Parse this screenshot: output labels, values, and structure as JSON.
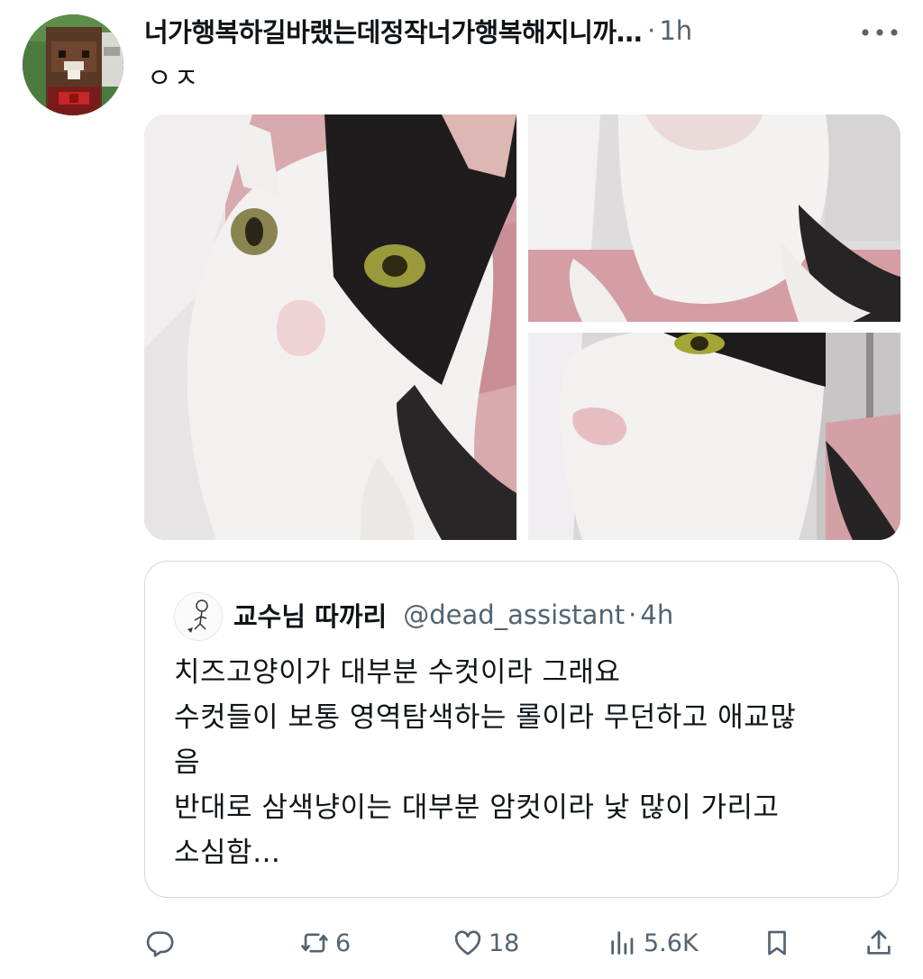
{
  "tweet": {
    "display_name": "너가행복하길바랬는데정작너가행복해지니까…",
    "separator": "·",
    "time": "1h",
    "text": "ㅇㅈ",
    "more_icon": "more-dots-icon",
    "photos": [
      {
        "icon": "photo-cat-closeup"
      },
      {
        "icon": "photo-cat-chin"
      },
      {
        "icon": "photo-cat-face-side"
      }
    ]
  },
  "quote": {
    "display_name": "교수님 따까리",
    "handle": "@dead_assistant",
    "separator": "·",
    "time": "4h",
    "lines": [
      "치즈고양이가 대부분 수컷이라 그래요",
      "수컷들이 보통 영역탐색하는 롤이라 무던하고 애교많",
      "음",
      "반대로 삼색냥이는 대부분 암컷이라 낯 많이 가리고",
      "소심함…"
    ]
  },
  "actions": {
    "reply": {
      "icon": "reply-icon",
      "count": ""
    },
    "retweet": {
      "icon": "retweet-icon",
      "count": "6"
    },
    "like": {
      "icon": "heart-icon",
      "count": "18"
    },
    "views": {
      "icon": "views-icon",
      "count": "5.6K"
    },
    "bookmark": {
      "icon": "bookmark-icon"
    },
    "share": {
      "icon": "share-icon"
    }
  },
  "colors": {
    "text": "#0f1419",
    "secondary": "#536471",
    "border": "#cfd9de"
  }
}
